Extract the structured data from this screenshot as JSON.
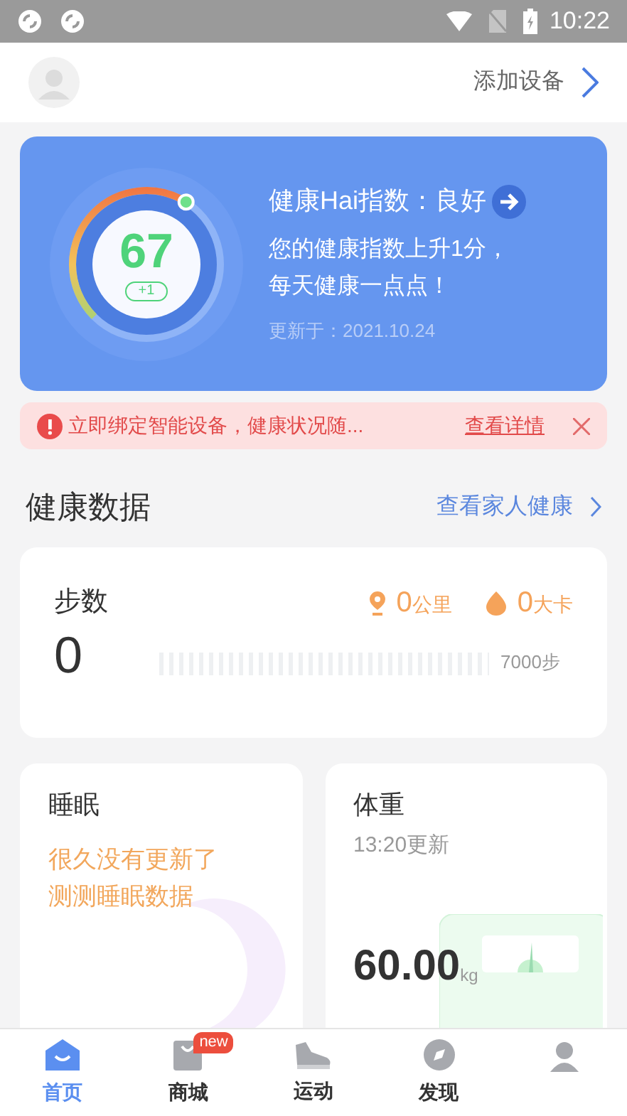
{
  "status_bar": {
    "time": "10:22"
  },
  "header": {
    "action": "添加设备"
  },
  "health_index": {
    "title": "健康Hai指数：良好",
    "score": "67",
    "change": "+1",
    "message": [
      "您的健康指数上升1分，",
      "每天健康一点点！"
    ],
    "updated": "更新于：2021.10.24"
  },
  "alert": {
    "text": "立即绑定智能设备，健康状况随...",
    "link": "查看详情"
  },
  "section": {
    "title": "健康数据",
    "link": "查看家人健康"
  },
  "steps": {
    "title": "步数",
    "distance": "0",
    "distance_unit": "公里",
    "calories": "0",
    "calories_unit": "大卡",
    "count": "0",
    "goal": "7000步"
  },
  "sleep": {
    "title": "睡眠",
    "message": [
      "很久没有更新了",
      "测测睡眠数据"
    ]
  },
  "weight": {
    "title": "体重",
    "updated": "13:20更新",
    "value": "60.00",
    "unit": "kg"
  },
  "tabs": [
    {
      "label": "首页",
      "selected": true,
      "kind": "home"
    },
    {
      "label": "商城",
      "selected": false,
      "kind": "shop",
      "badge": "new"
    },
    {
      "label": "运动",
      "selected": false,
      "kind": "shoe"
    },
    {
      "label": "发现",
      "selected": false,
      "kind": "discover"
    },
    {
      "selected": false,
      "kind": "profile"
    }
  ]
}
